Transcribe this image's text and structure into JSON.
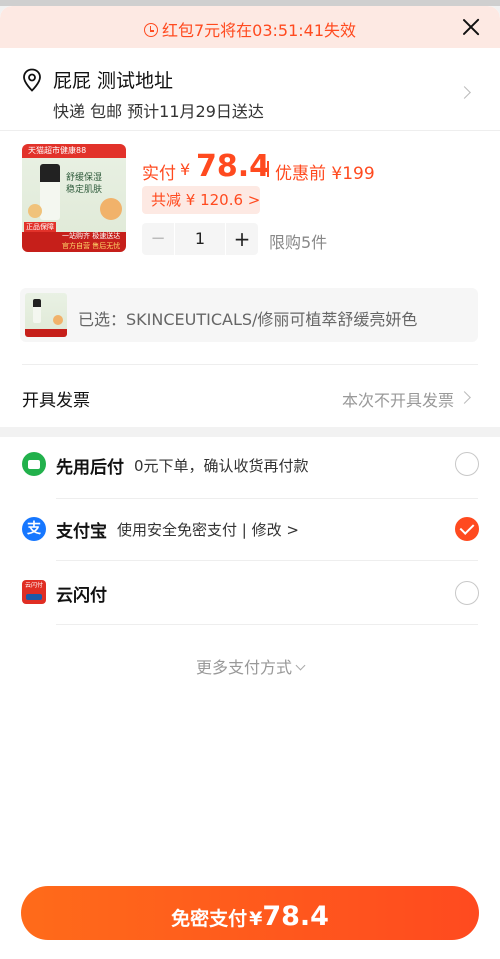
{
  "banner": {
    "countdown_text": "红包7元将在03:51:41失效"
  },
  "address": {
    "name": "屁屁 测试地址",
    "delivery": "快递 包邮 预计11月29日送达"
  },
  "product": {
    "pay_label": "实付",
    "currency": "¥",
    "pay_amount": "78.4",
    "original_price": "优惠前 ¥199",
    "discount_text": "共减 ¥ 120.6 >",
    "quantity": "1",
    "limit_text": "限购5件",
    "thumb": {
      "top_bar": "天猫超市健康88",
      "caption_1": "舒缓保湿",
      "caption_2": "稳定肌肤",
      "bottom_left": "正品保障",
      "bottom_mid": "一站购齐 极速送达",
      "bottom_right": "官方自营 售后无忧"
    }
  },
  "sku": {
    "selected_text": "已选：SKINCEUTICALS/修丽可植萃舒缓亮妍色"
  },
  "invoice": {
    "label": "开具发票",
    "value": "本次不开具发票"
  },
  "payment_methods": [
    {
      "name": "先用后付",
      "desc": "0元下单，确认收货再付款",
      "selected": false,
      "icon": "pay-later-icon"
    },
    {
      "name": "支付宝",
      "desc": "使用安全免密支付 | 修改 >",
      "selected": true,
      "icon": "alipay-icon"
    },
    {
      "name": "云闪付",
      "desc": "",
      "selected": false,
      "icon": "unionpay-icon"
    }
  ],
  "more_payment": "更多支付方式",
  "pay_button": {
    "label": "免密支付",
    "currency": "¥",
    "amount": "78.4"
  },
  "colors": {
    "accent": "#ff4a1f",
    "banner_bg": "#fde9e3",
    "alipay_blue": "#1677ff",
    "pay_later_green": "#22b14c"
  }
}
